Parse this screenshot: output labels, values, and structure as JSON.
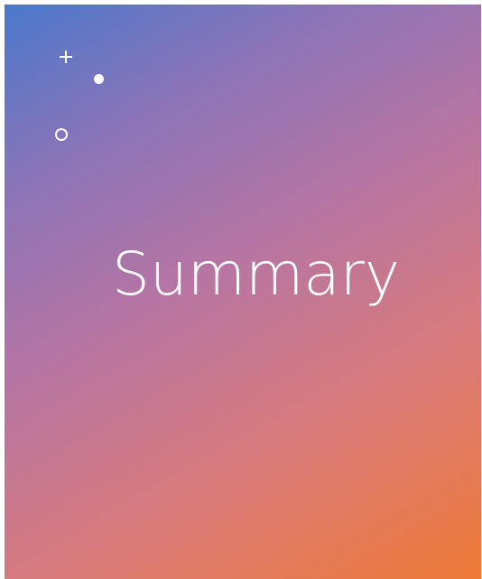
{
  "slide": {
    "title": "Summary",
    "decorations": [
      "plus-icon",
      "dot-icon",
      "ring-icon"
    ],
    "gradient_colors": [
      "#4a78cc",
      "#8a74b8",
      "#b675a3",
      "#d87a7c",
      "#ee7a36"
    ],
    "text_color": "#ffffff"
  }
}
